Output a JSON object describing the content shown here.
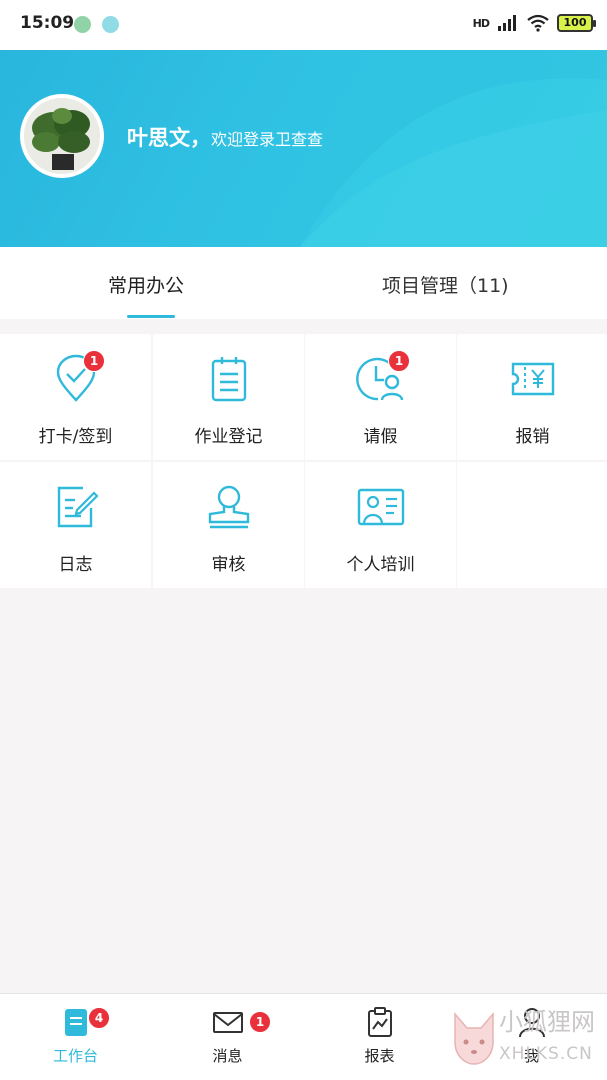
{
  "status_bar": {
    "time": "15:09",
    "network": "HD",
    "battery": "100"
  },
  "header": {
    "name": "叶思文，",
    "message": "欢迎登录卫查查"
  },
  "tabs": [
    {
      "label": "常用办公",
      "active": true
    },
    {
      "label": "项目管理（11)",
      "active": false
    }
  ],
  "grid": [
    {
      "label": "打卡/签到",
      "icon": "location-check-icon",
      "badge": "1"
    },
    {
      "label": "作业登记",
      "icon": "clipboard-icon",
      "badge": ""
    },
    {
      "label": "请假",
      "icon": "clock-person-icon",
      "badge": "1"
    },
    {
      "label": "报销",
      "icon": "receipt-yen-icon",
      "badge": ""
    },
    {
      "label": "日志",
      "icon": "edit-doc-icon",
      "badge": ""
    },
    {
      "label": "审核",
      "icon": "stamp-icon",
      "badge": ""
    },
    {
      "label": "个人培训",
      "icon": "training-board-icon",
      "badge": ""
    }
  ],
  "bottom_nav": [
    {
      "label": "工作台",
      "icon": "workbench-icon",
      "badge": "4",
      "active": true
    },
    {
      "label": "消息",
      "icon": "mail-icon",
      "badge": "1",
      "active": false
    },
    {
      "label": "报表",
      "icon": "report-icon",
      "badge": "",
      "active": false
    },
    {
      "label": "我",
      "icon": "user-icon",
      "badge": "",
      "active": false
    }
  ],
  "watermark": {
    "title": "小狐狸网",
    "domain": "XHLKS.CN"
  },
  "colors": {
    "accent": "#2fb9da",
    "badge": "#e8313a",
    "header_start": "#2ab7de",
    "header_end": "#37cde3"
  }
}
